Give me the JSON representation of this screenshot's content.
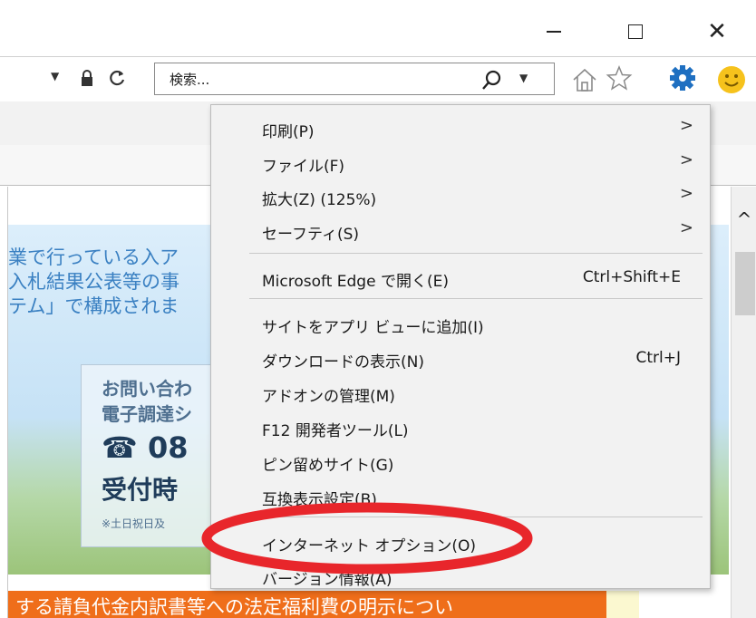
{
  "toolbar": {
    "search_placeholder": "検索..."
  },
  "page": {
    "banner_lines": [
      "業で行っている入ア",
      "入札結果公表等の事",
      "テム」で構成されま"
    ],
    "contact": {
      "line1": "お問い合わ",
      "line2": "電子調達シ",
      "phone": "☎ 08",
      "hours": "受付時",
      "note": "※土日祝日及"
    },
    "notice": "する請負代金内訳書等への法定福利費の明示につい"
  },
  "menu": {
    "items": [
      {
        "label": "印刷(P)",
        "shortcut": "",
        "submenu": true
      },
      {
        "label": "ファイル(F)",
        "shortcut": "",
        "submenu": true
      },
      {
        "label": "拡大(Z) (125%)",
        "shortcut": "",
        "submenu": true
      },
      {
        "label": "セーフティ(S)",
        "shortcut": "",
        "submenu": true
      },
      {
        "label": "Microsoft Edge で開く(E)",
        "shortcut": "Ctrl+Shift+E",
        "submenu": false
      },
      {
        "label": "サイトをアプリ ビューに追加(I)",
        "shortcut": "",
        "submenu": false
      },
      {
        "label": "ダウンロードの表示(N)",
        "shortcut": "Ctrl+J",
        "submenu": false
      },
      {
        "label": "アドオンの管理(M)",
        "shortcut": "",
        "submenu": false
      },
      {
        "label": "F12 開発者ツール(L)",
        "shortcut": "",
        "submenu": false
      },
      {
        "label": "ピン留めサイト(G)",
        "shortcut": "",
        "submenu": false
      },
      {
        "label": "互換表示設定(B)",
        "shortcut": "",
        "submenu": false
      },
      {
        "label": "インターネット オプション(O)",
        "shortcut": "",
        "submenu": false
      },
      {
        "label": "バージョン情報(A)",
        "shortcut": "",
        "submenu": false
      }
    ],
    "arrow_glyph": ">"
  },
  "icons": {
    "minimize": "minimize-icon",
    "maximize": "maximize-icon",
    "close": "close-icon",
    "lock": "lock-icon",
    "refresh": "refresh-icon",
    "search": "search-icon",
    "home": "home-icon",
    "favorites": "star-icon",
    "tools": "gear-icon",
    "feedback": "smiley-icon"
  },
  "colors": {
    "menu_bg": "#f2f2f2",
    "highlight": "#e8262b",
    "gear": "#1e6fc1",
    "smiley": "#f6c21c",
    "banner_text": "#3a80c2",
    "notice_bar": "#ef6e1a"
  }
}
